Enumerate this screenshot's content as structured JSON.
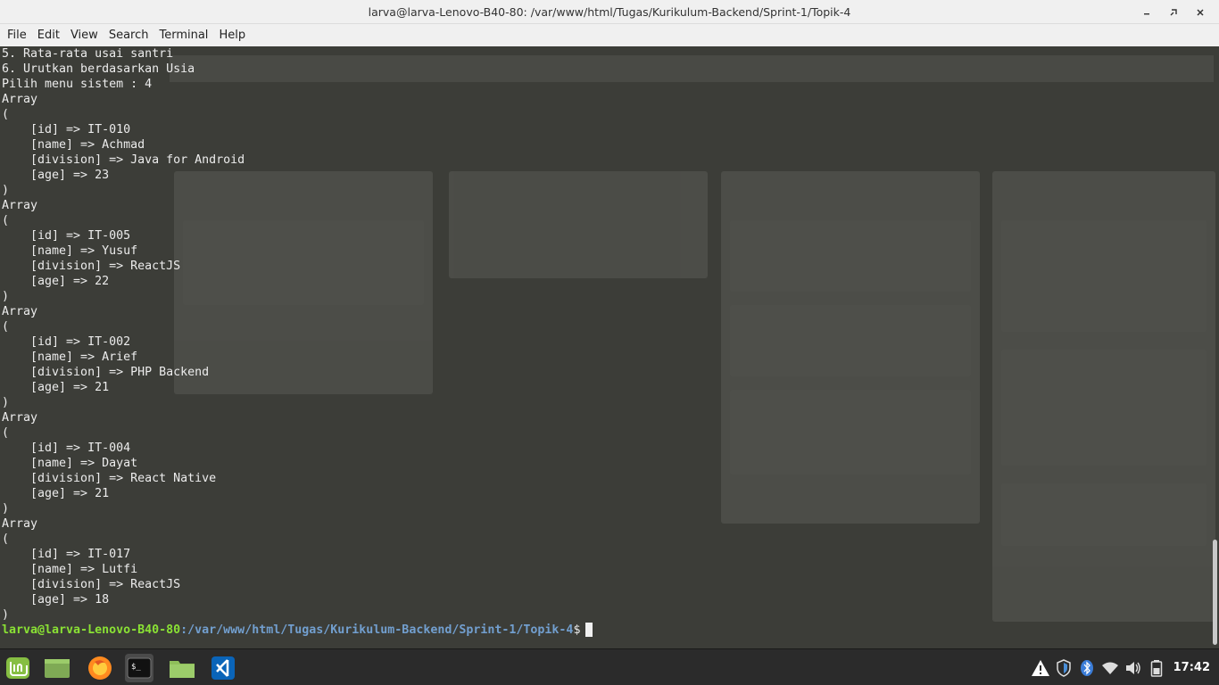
{
  "window": {
    "title": "larva@larva-Lenovo-B40-80: /var/www/html/Tugas/Kurikulum-Backend/Sprint-1/Topik-4"
  },
  "menu": [
    "File",
    "Edit",
    "View",
    "Search",
    "Terminal",
    "Help"
  ],
  "terminal": {
    "lines": [
      "5. Rata-rata usai santri",
      "6. Urutkan berdasarkan Usia",
      "Pilih menu sistem : 4",
      "Array",
      "(",
      "    [id] => IT-010",
      "    [name] => Achmad",
      "    [division] => Java for Android",
      "    [age] => 23",
      ")",
      "Array",
      "(",
      "    [id] => IT-005",
      "    [name] => Yusuf",
      "    [division] => ReactJS",
      "    [age] => 22",
      ")",
      "Array",
      "(",
      "    [id] => IT-002",
      "    [name] => Arief",
      "    [division] => PHP Backend",
      "    [age] => 21",
      ")",
      "Array",
      "(",
      "    [id] => IT-004",
      "    [name] => Dayat",
      "    [division] => React Native",
      "    [age] => 21",
      ")",
      "Array",
      "(",
      "    [id] => IT-017",
      "    [name] => Lutfi",
      "    [division] => ReactJS",
      "    [age] => 18",
      ")"
    ],
    "prompt": {
      "user": "larva@larva-Lenovo-B40-80",
      "path": ":/var/www/html/Tugas/Kurikulum-Backend/Sprint-1/Topik-4",
      "symbol": "$"
    }
  },
  "taskbar": {
    "apps": [
      "mint-menu-icon",
      "show-desktop-icon",
      "firefox-icon",
      "terminal-icon",
      "files-icon",
      "vscode-icon"
    ],
    "tray": [
      "warning-icon",
      "shield-icon",
      "bluetooth-icon",
      "wifi-icon",
      "volume-icon",
      "battery-icon"
    ],
    "clock": "17:42"
  },
  "colors": {
    "terminal_bg": "#3c3d38",
    "prompt_user": "#8ae234",
    "prompt_path": "#729fcf",
    "taskbar_bg": "#2b2b2b"
  }
}
